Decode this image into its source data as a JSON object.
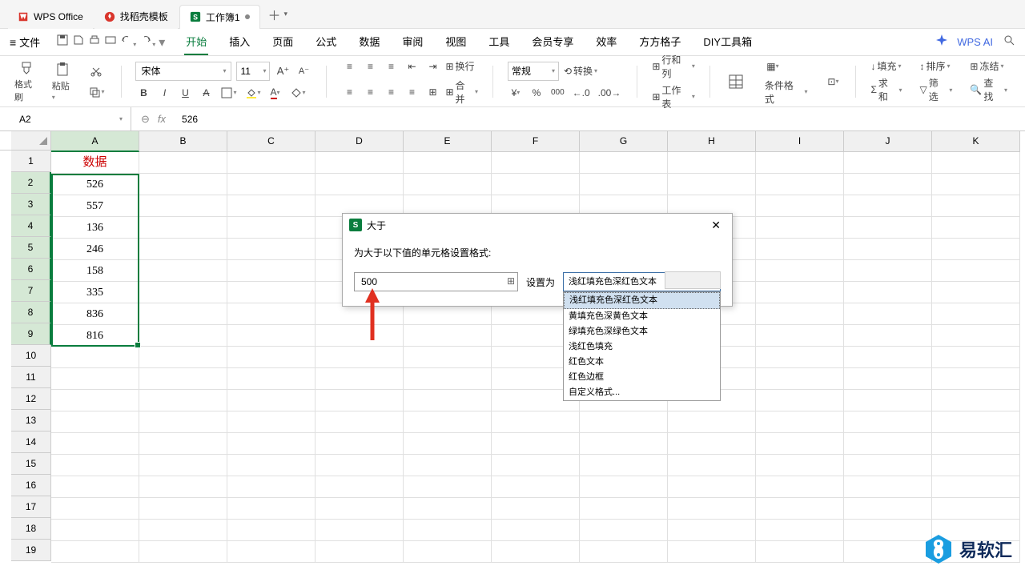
{
  "title_tabs": {
    "t0": "WPS Office",
    "t1": "找稻壳模板",
    "t2": "工作簿1"
  },
  "menu": {
    "file": "文件",
    "items": {
      "start": "开始",
      "insert": "插入",
      "page": "页面",
      "formula": "公式",
      "data": "数据",
      "review": "审阅",
      "view": "视图",
      "tool": "工具",
      "member": "会员专享",
      "effect": "效率",
      "fanggezi": "方方格子",
      "diy": "DIY工具箱"
    },
    "ai": "WPS AI"
  },
  "ribbon": {
    "format_painter": "格式刷",
    "paste": "粘贴",
    "font": "宋体",
    "font_size": "11",
    "number_format": "常规",
    "wrap": "换行",
    "merge": "合并",
    "convert": "转换",
    "rowcol": "行和列",
    "worksheet": "工作表",
    "cond_fmt": "条件格式",
    "fill": "填充",
    "sort": "排序",
    "freeze": "冻结",
    "sum": "求和",
    "filter": "筛选",
    "find": "查找"
  },
  "formula_bar": {
    "cell_ref": "A2",
    "value": "526"
  },
  "columns": [
    "A",
    "B",
    "C",
    "D",
    "E",
    "F",
    "G",
    "H",
    "I",
    "J",
    "K"
  ],
  "rows": [
    "1",
    "2",
    "3",
    "4",
    "5",
    "6",
    "7",
    "8",
    "9",
    "10",
    "11",
    "12",
    "13",
    "14",
    "15",
    "16",
    "17",
    "18",
    "19"
  ],
  "data_header": "数据",
  "data_values": [
    "526",
    "557",
    "136",
    "246",
    "158",
    "335",
    "836",
    "816"
  ],
  "dialog": {
    "title": "大于",
    "prompt": "为大于以下值的单元格设置格式:",
    "value": "500",
    "set_as": "设置为",
    "selected": "浅红填充色深红色文本",
    "options": [
      "浅红填充色深红色文本",
      "黄填充色深黄色文本",
      "绿填充色深绿色文本",
      "浅红色填充",
      "红色文本",
      "红色边框",
      "自定义格式..."
    ]
  },
  "watermark": "易软汇"
}
